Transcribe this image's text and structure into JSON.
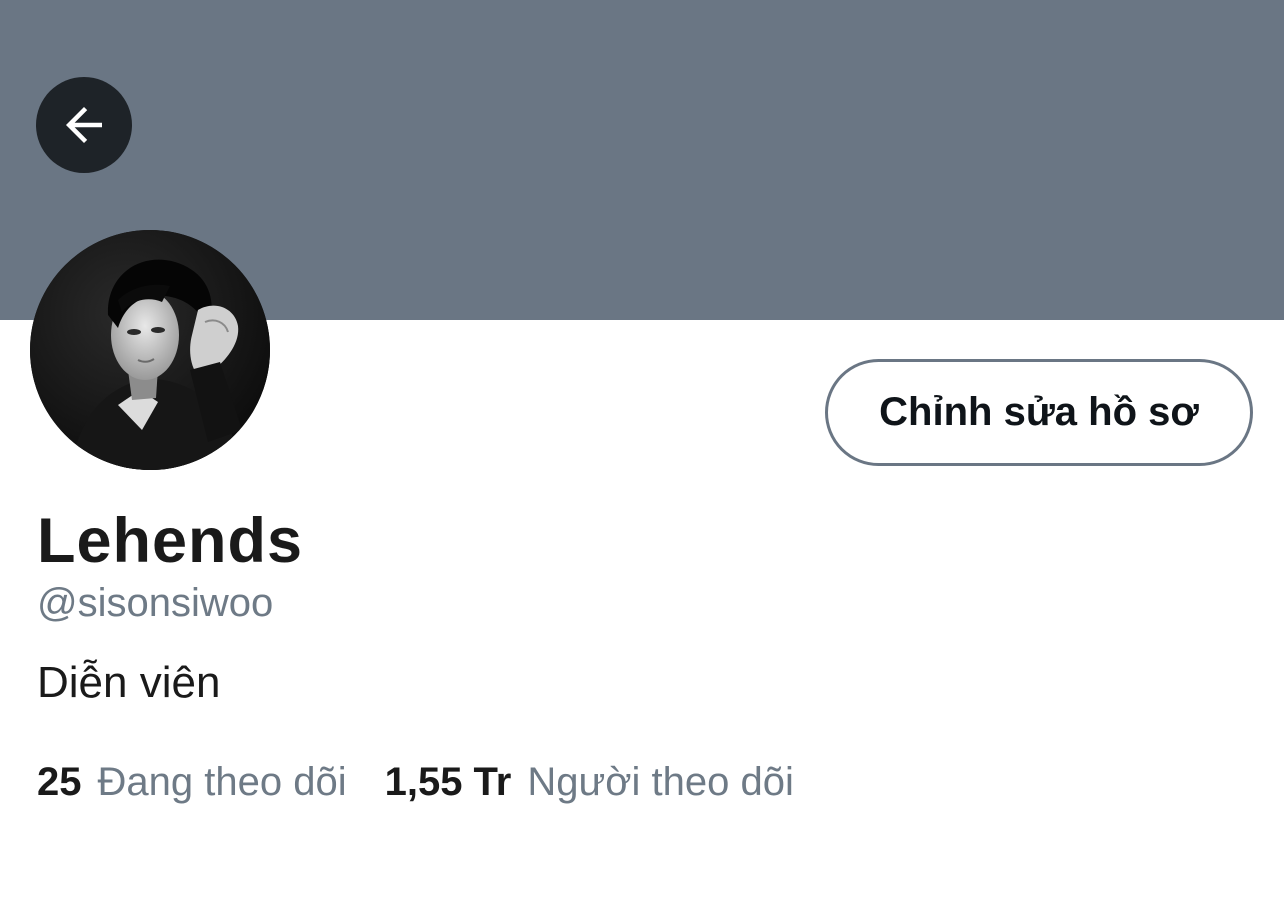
{
  "colors": {
    "banner": "#6a7684",
    "back_button_bg": "#1e2328",
    "border": "#6a7684",
    "text_primary": "#1a1a1a",
    "text_secondary": "#6e7a86"
  },
  "header": {
    "back_icon": "arrow-left-icon"
  },
  "profile": {
    "avatar_alt": "profile photo",
    "edit_button_label": "Chỉnh sửa hồ sơ",
    "display_name": "Lehends",
    "handle": "@sisonsiwoo",
    "bio": "Diễn viên"
  },
  "stats": {
    "following_count": "25",
    "following_label": "Đang theo dõi",
    "followers_count": "1,55 Tr",
    "followers_label": "Người theo dõi"
  }
}
